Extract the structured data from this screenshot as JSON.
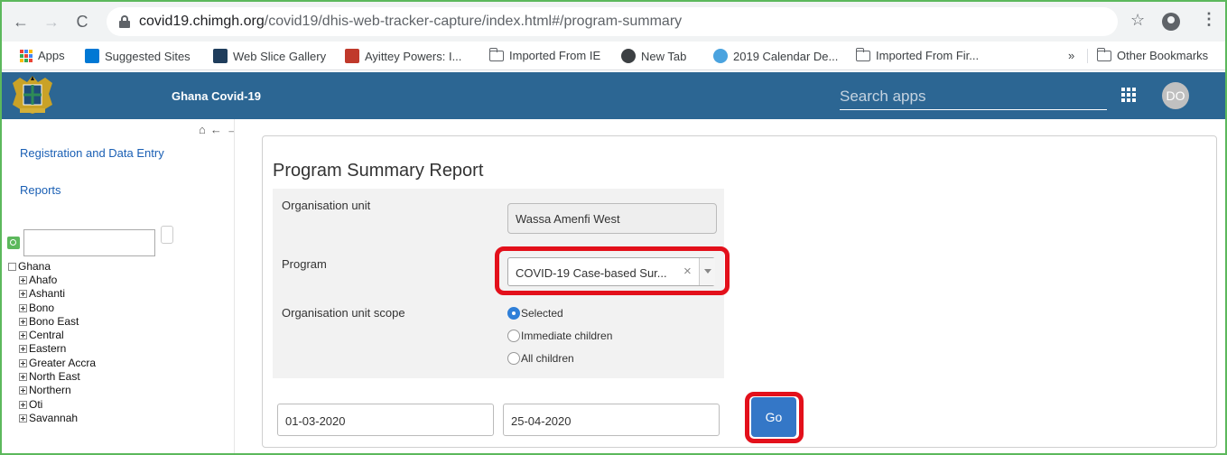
{
  "browser": {
    "url_host": "covid19.chimgh.org",
    "url_path": "/covid19/dhis-web-tracker-capture/index.html#/program-summary",
    "back": "←",
    "forward": "→",
    "reload": "C",
    "star": "☆",
    "menu": "⋮",
    "bookmarks": {
      "apps": "Apps",
      "suggested": "Suggested Sites",
      "webslice": "Web Slice Gallery",
      "ayittey": "Ayittey Powers: I...",
      "imported_ie": "Imported From IE",
      "newtab": "New Tab",
      "calendar": "2019 Calendar De...",
      "imported_fir": "Imported From Fir...",
      "more": "»",
      "other": "Other Bookmarks"
    }
  },
  "header": {
    "title": "Ghana Covid-19",
    "search_placeholder": "Search apps",
    "avatar": "DO"
  },
  "sidebar": {
    "nav_icons": "⌂←→",
    "links": [
      "Registration and Data Entry",
      "Reports"
    ],
    "tree_root": "Ghana",
    "tree_items": [
      "Ahafo",
      "Ashanti",
      "Bono",
      "Bono East",
      "Central",
      "Eastern",
      "Greater Accra",
      "North East",
      "Northern",
      "Oti",
      "Savannah"
    ]
  },
  "report": {
    "title": "Program Summary Report",
    "org_unit_label": "Organisation unit",
    "org_unit_value": "Wassa Amenfi West",
    "program_label": "Program",
    "program_value": "COVID-19 Case-based Sur...",
    "program_clear": "×",
    "scope_label": "Organisation unit scope",
    "scope_options": [
      "Selected",
      "Immediate children",
      "All children"
    ],
    "start_date": "01-03-2020",
    "end_date": "25-04-2020",
    "go_label": "Go"
  },
  "colors": {
    "header_bg": "#2c6693",
    "highlight": "#e3101b",
    "go_button": "#3477c7",
    "frame": "#5cb85c"
  }
}
